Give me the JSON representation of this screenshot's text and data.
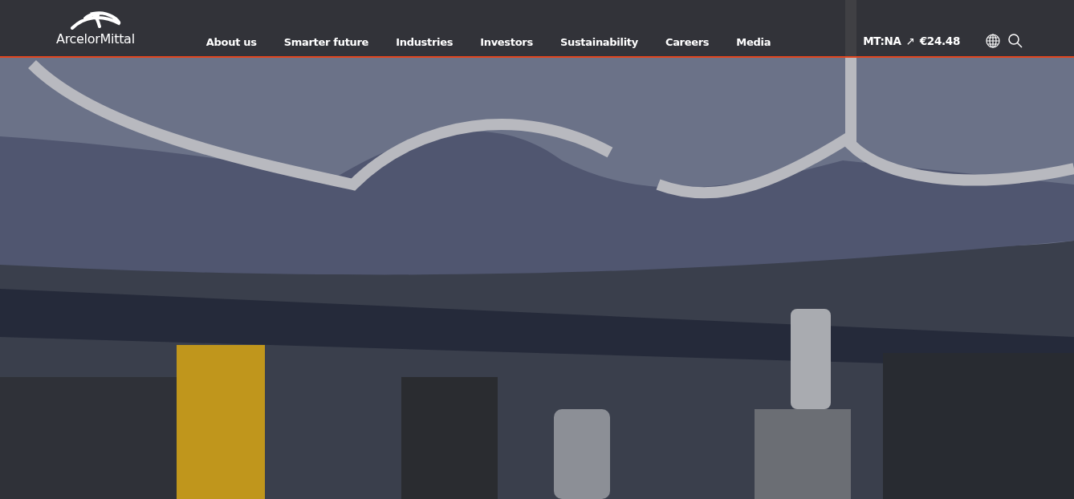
{
  "header": {
    "logo": "ArcelorMittal",
    "nav": [
      "About us",
      "Smarter future",
      "Industries",
      "Investors",
      "Sustainability",
      "Careers",
      "Media"
    ],
    "stock": {
      "ticker": "MT:NA",
      "trend": "↗",
      "price": "€24.48"
    }
  }
}
